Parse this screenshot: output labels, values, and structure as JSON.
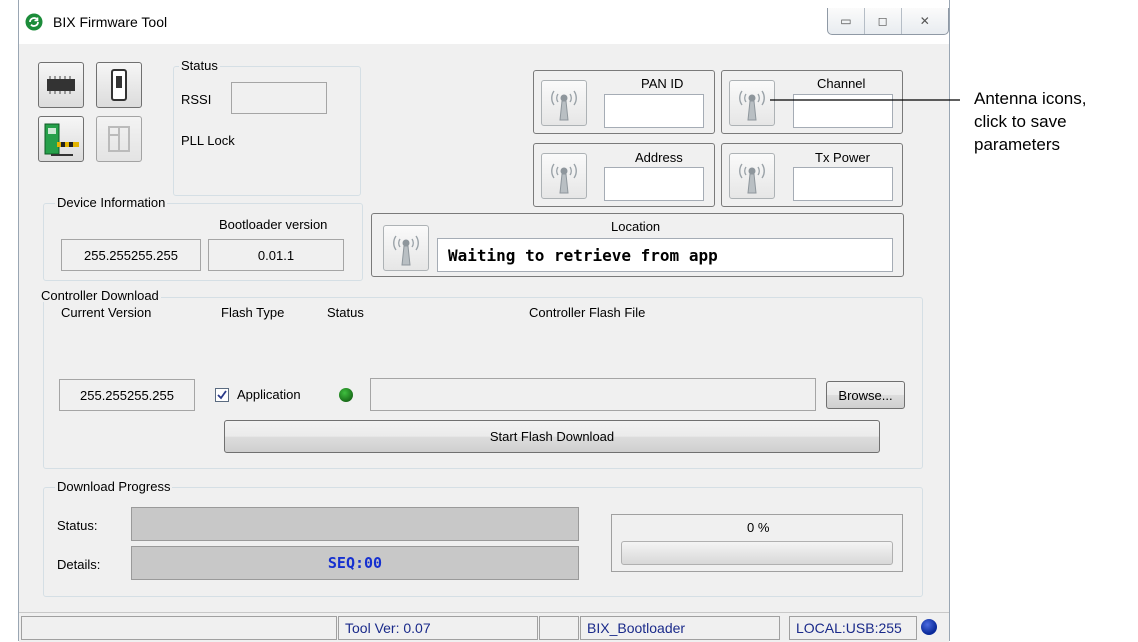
{
  "window": {
    "title": "BIX Firmware Tool",
    "controls": {
      "minimize": "▭",
      "maximize": "◻",
      "close": "✕"
    }
  },
  "status_group": {
    "label": "Status",
    "rssi_label": "RSSI",
    "rssi_value": "",
    "pll_label": "PLL Lock"
  },
  "radio_params": {
    "pan_id": {
      "label": "PAN ID",
      "value": ""
    },
    "channel": {
      "label": "Channel",
      "value": ""
    },
    "address": {
      "label": "Address",
      "value": ""
    },
    "tx_power": {
      "label": "Tx Power",
      "value": ""
    },
    "location": {
      "label": "Location",
      "value": "Waiting to retrieve from app"
    }
  },
  "device_info": {
    "label": "Device Information",
    "ip_value": "255.255255.255",
    "bootloader_label": "Bootloader version",
    "bootloader_value": "0.01.1"
  },
  "controller_download": {
    "label": "Controller Download",
    "col_current_version": "Current Version",
    "col_flash_type": "Flash Type",
    "col_status": "Status",
    "col_flash_file": "Controller Flash File",
    "current_version_value": "255.255255.255",
    "application_label": "Application",
    "application_checked": true,
    "status_led_color": "#1f7a1f",
    "flash_file_value": "",
    "browse_label": "Browse...",
    "start_label": "Start Flash Download"
  },
  "download_progress": {
    "label": "Download Progress",
    "status_label": "Status:",
    "status_value": "",
    "details_label": "Details:",
    "details_value": "SEQ:00",
    "percent_text": "0 %",
    "progress": 0
  },
  "statusbar": {
    "tool_version": "Tool Ver:  0.07",
    "mode": "BIX_Bootloader",
    "connection": "LOCAL:USB:255",
    "indicator_color": "#0a2a9a"
  },
  "annotation": {
    "line1": "Antenna icons,",
    "line2": "click to save",
    "line3": "parameters"
  },
  "colors": {
    "accent_text": "#1a2a8a",
    "details_text": "#1530d0"
  }
}
